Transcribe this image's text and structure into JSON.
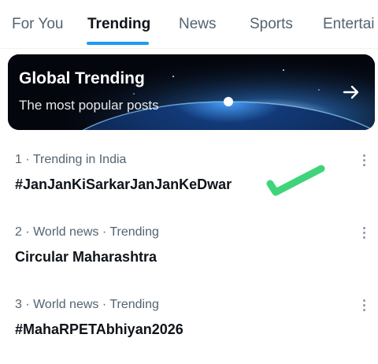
{
  "tabs": [
    {
      "label": "For You"
    },
    {
      "label": "Trending"
    },
    {
      "label": "News"
    },
    {
      "label": "Sports"
    },
    {
      "label": "Entertai"
    }
  ],
  "active_tab": "Trending",
  "banner": {
    "title": "Global Trending",
    "subtitle": "The most popular posts",
    "arrow_icon": "arrow-right-icon"
  },
  "trends": [
    {
      "meta": "1 · Trending in India",
      "name": "#JanJanKiSarkarJanJanKeDwar"
    },
    {
      "meta": "2 · World news · Trending",
      "name": "Circular Maharashtra"
    },
    {
      "meta": "3 · World news · Trending",
      "name": "#MahaRPETAbhiyan2026"
    }
  ],
  "annotation": {
    "icon": "checkmark-icon",
    "color": "#3fd47a"
  },
  "colors": {
    "accent": "#1d9bf0",
    "text": "#0f1419",
    "secondary": "#536471"
  }
}
